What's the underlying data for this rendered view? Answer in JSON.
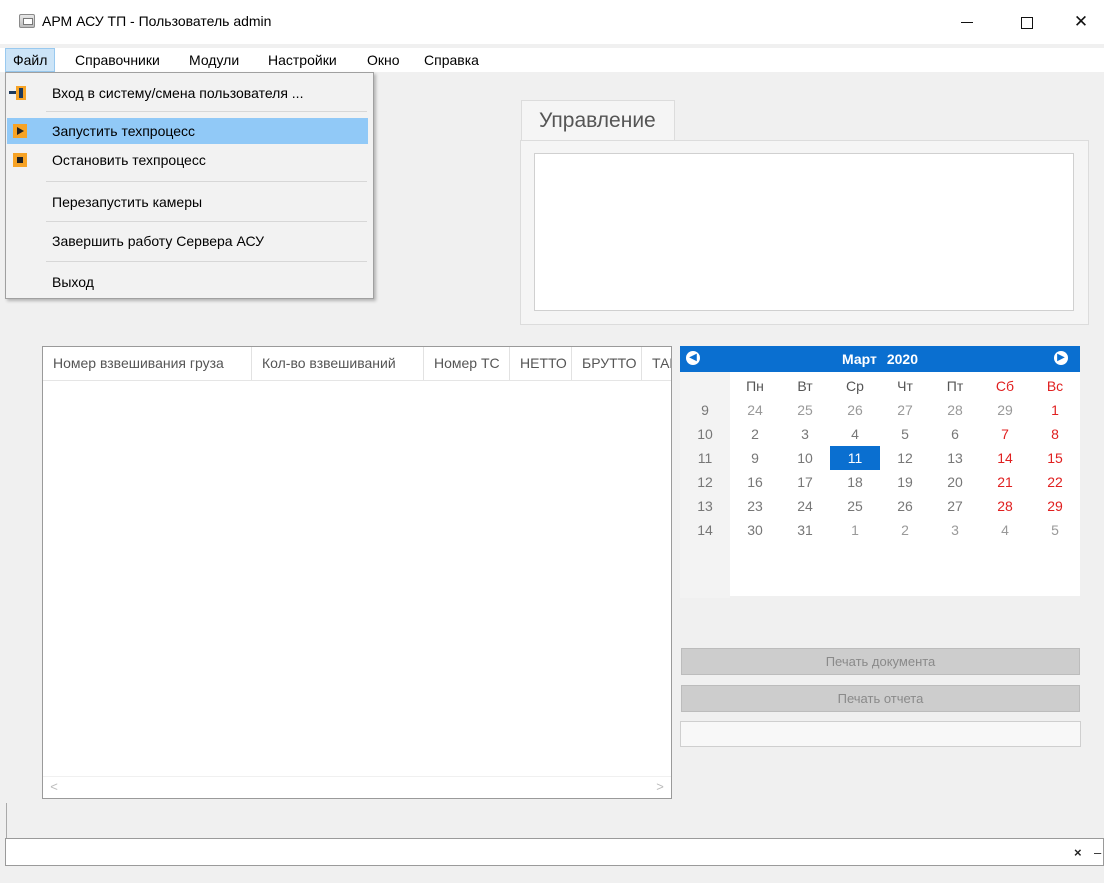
{
  "window": {
    "title": "АРМ АСУ ТП - Пользователь admin",
    "minimize": "minimize",
    "maximize": "maximize",
    "close": "✕"
  },
  "menubar": {
    "items": [
      {
        "label": "Файл"
      },
      {
        "label": "Справочники"
      },
      {
        "label": "Модули"
      },
      {
        "label": "Настройки"
      },
      {
        "label": "Окно"
      },
      {
        "label": "Справка"
      }
    ]
  },
  "file_menu": {
    "items": [
      {
        "label": "Вход в систему/смена пользователя ...",
        "icon": "login-icon"
      },
      {
        "label": "Запустить техпроцесс",
        "icon": "play-icon"
      },
      {
        "label": "Остановить техпроцесс",
        "icon": "stop-icon"
      },
      {
        "label": "Перезапустить камеры"
      },
      {
        "label": "Завершить работу Сервера АСУ"
      },
      {
        "label": "Выход"
      }
    ]
  },
  "control": {
    "tab_label": "Управление"
  },
  "table": {
    "columns": [
      "Номер взвешивания груза",
      "Кол-во взвешиваний",
      "Номер ТС",
      "НЕТТО",
      "БРУТТО",
      "ТАРА"
    ],
    "scroll_left": "<",
    "scroll_right": ">"
  },
  "calendar": {
    "month": "Март",
    "year": "2020",
    "weekdays": [
      "Пн",
      "Вт",
      "Ср",
      "Чт",
      "Пт",
      "Сб",
      "Вс"
    ],
    "weeks": [
      {
        "num": "9",
        "days": [
          "24",
          "25",
          "26",
          "27",
          "28",
          "29",
          "1"
        ]
      },
      {
        "num": "10",
        "days": [
          "2",
          "3",
          "4",
          "5",
          "6",
          "7",
          "8"
        ]
      },
      {
        "num": "11",
        "days": [
          "9",
          "10",
          "11",
          "12",
          "13",
          "14",
          "15"
        ]
      },
      {
        "num": "12",
        "days": [
          "16",
          "17",
          "18",
          "19",
          "20",
          "21",
          "22"
        ]
      },
      {
        "num": "13",
        "days": [
          "23",
          "24",
          "25",
          "26",
          "27",
          "28",
          "29"
        ]
      },
      {
        "num": "14",
        "days": [
          "30",
          "31",
          "1",
          "2",
          "3",
          "4",
          "5"
        ]
      }
    ],
    "selected_day": "11"
  },
  "buttons": {
    "print_document": "Печать документа",
    "print_report": "Печать отчета"
  },
  "bottom": {
    "close": "×",
    "dash": "–"
  },
  "colors": {
    "accent": "#0a6fd0",
    "weekend": "#e02020",
    "menu_highlight": "#91c9f7"
  }
}
